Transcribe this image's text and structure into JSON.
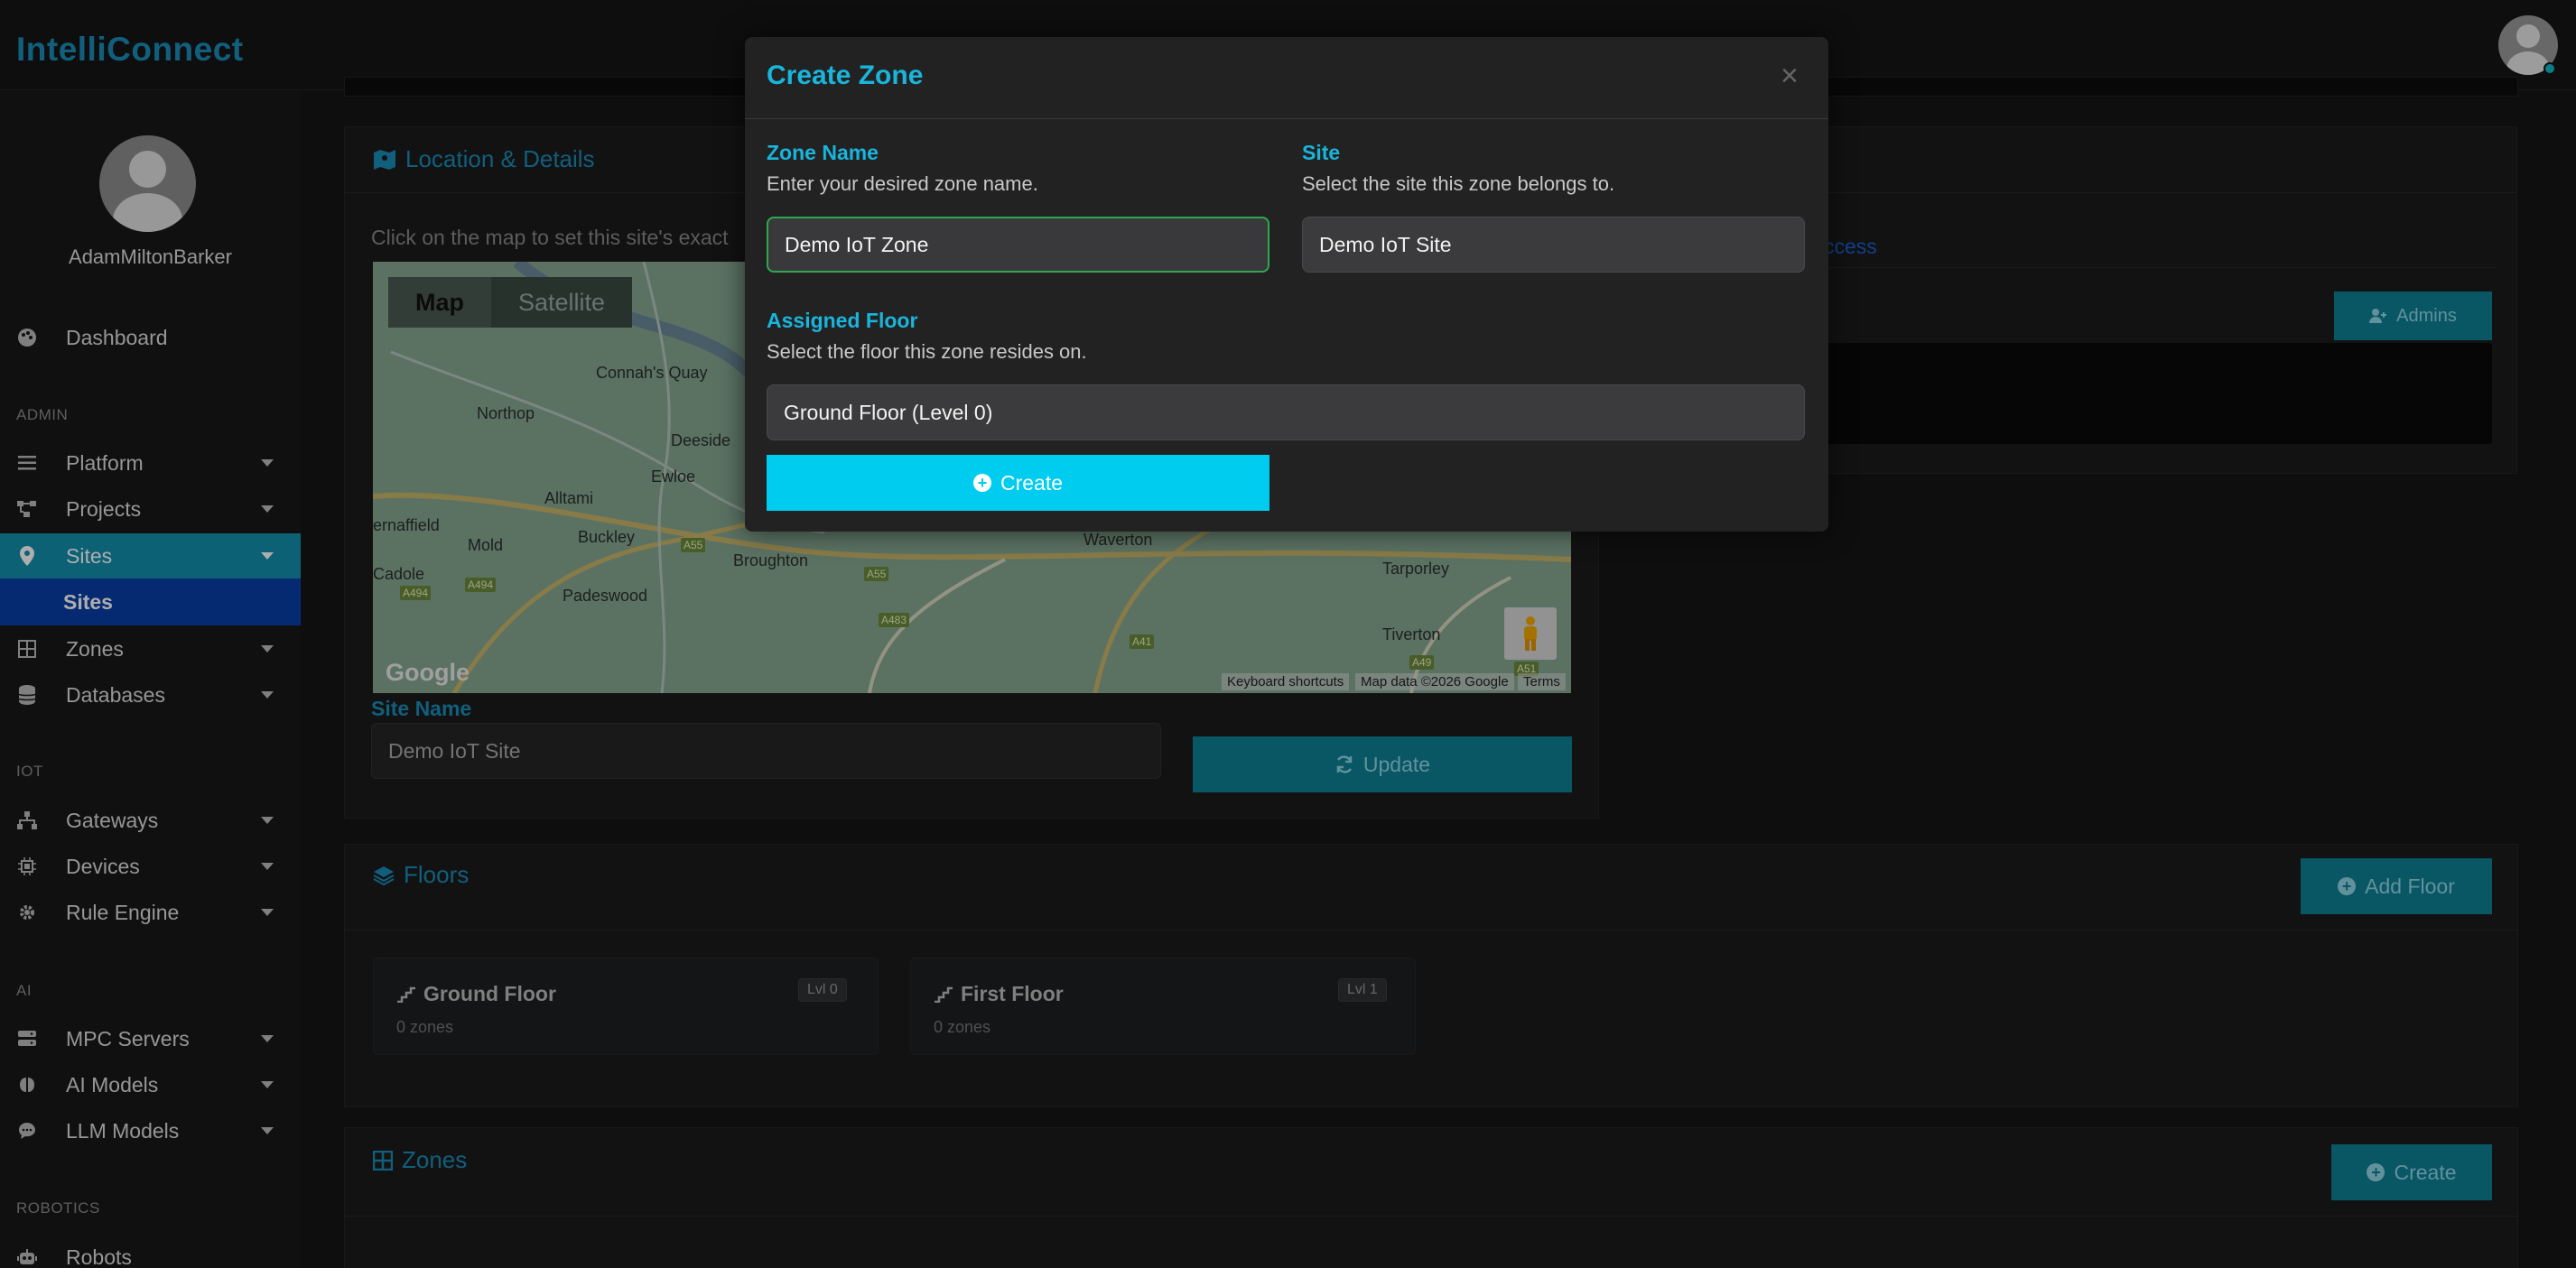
{
  "app": {
    "brand": "IntelliConnect"
  },
  "user": {
    "name": "AdamMiltonBarker"
  },
  "sidebar": {
    "items": [
      {
        "label": "Dashboard"
      },
      {
        "section": "ADMIN"
      },
      {
        "label": "Platform"
      },
      {
        "label": "Projects"
      },
      {
        "label": "Sites"
      },
      {
        "sub": "Sites"
      },
      {
        "label": "Zones"
      },
      {
        "label": "Databases"
      },
      {
        "section": "IOT"
      },
      {
        "label": "Gateways"
      },
      {
        "label": "Devices"
      },
      {
        "label": "Rule Engine"
      },
      {
        "section": "AI"
      },
      {
        "label": "MPC Servers"
      },
      {
        "label": "AI Models"
      },
      {
        "label": "LLM Models"
      },
      {
        "section": "ROBOTICS"
      },
      {
        "label": "Robots"
      }
    ]
  },
  "location": {
    "title": "Location & Details",
    "hint": "Click on the map to set this site's exact",
    "map_tabs": [
      "Map",
      "Satellite"
    ],
    "map_places": [
      "Connah's Quay",
      "Northop",
      "Deeside",
      "Ewloe",
      "Alltami",
      "Buckley",
      "Mold",
      "Padeswood",
      "Broughton",
      "Cadole",
      "Waverton",
      "Tarporley",
      "Tiverton"
    ],
    "map_partial_place": "ernaffield",
    "roads": [
      "A55",
      "A494",
      "A494",
      "A55",
      "A483",
      "A41",
      "A49",
      "A51"
    ],
    "google": "Google",
    "map_footer": [
      "Keyboard shortcuts",
      "Map data ©2026 Google",
      "Terms"
    ],
    "site_name_label": "Site Name",
    "site_name_value": "Demo IoT Site",
    "update_label": "Update"
  },
  "access": {
    "tab_partial": "ccess",
    "admins_label": "Admins"
  },
  "floors": {
    "title": "Floors",
    "add_label": "Add Floor",
    "cards": [
      {
        "name": "Ground Floor",
        "zones": "0 zones",
        "badge": "Lvl 0"
      },
      {
        "name": "First Floor",
        "zones": "0 zones",
        "badge": "Lvl 1"
      }
    ]
  },
  "zones_panel": {
    "title": "Zones",
    "create_label": "Create"
  },
  "modal": {
    "title": "Create Zone",
    "close": "×",
    "zone_name_label": "Zone Name",
    "zone_name_help": "Enter your desired zone name.",
    "zone_name_value": "Demo IoT Zone",
    "site_label": "Site",
    "site_help": "Select the site this zone belongs to.",
    "site_value": "Demo IoT Site",
    "floor_label": "Assigned Floor",
    "floor_help": "Select the floor this zone resides on.",
    "floor_value": "Ground Floor (Level 0)",
    "create_label": "Create"
  },
  "colors": {
    "accent": "#19b5dc",
    "active_nav": "#1290ad",
    "sub_nav": "#0a3fa8",
    "create_button": "#00ccf0"
  }
}
